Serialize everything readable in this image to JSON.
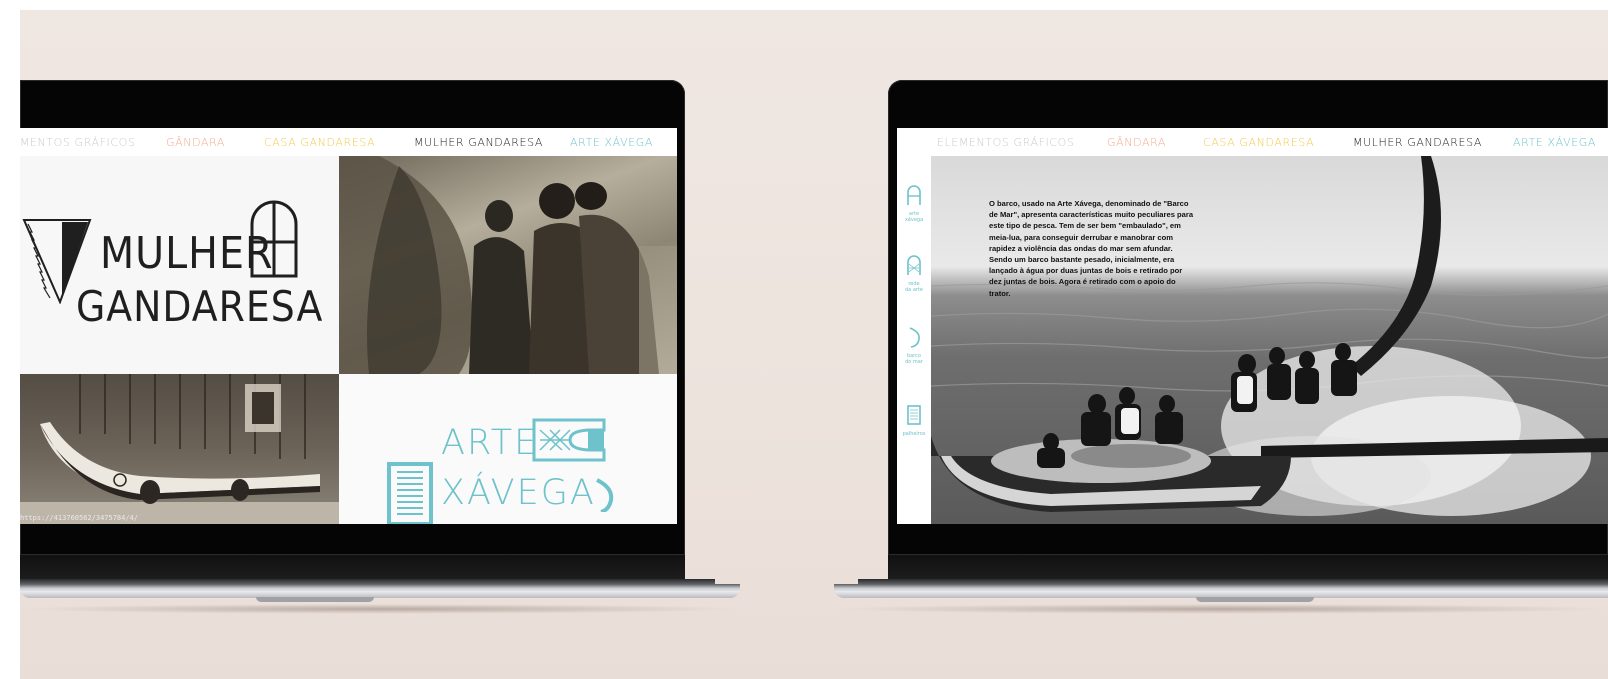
{
  "colors": {
    "backdrop": "#eee5df",
    "accent_teal": "#6dc2cb",
    "accent_peach": "#f0a98c",
    "accent_yellow": "#f2c84b",
    "nav_gray": "#c9c9c9",
    "nav_dark": "#1e1e1e"
  },
  "left_laptop": {
    "nav": [
      {
        "label": "ELEMENTOS GRÁFICOS",
        "color": "#c9c9c9"
      },
      {
        "label": "GÂNDARA",
        "color": "#f0a98c"
      },
      {
        "label": "CASA GANDARESA",
        "color": "#f2c84b"
      },
      {
        "label": "MULHER GANDARESA",
        "color": "#1e1e1e"
      },
      {
        "label": "ARTE XÁVEGA",
        "color": "#6dc2cb"
      }
    ],
    "title_line1": "MULHER",
    "title_line2": "GANDARESA",
    "arte_line1": "ARTE",
    "arte_line2": "XÁVEGA",
    "url_caption": "https://41376056​2/3475784/4/",
    "icons": [
      "triangle-emblem-icon",
      "arch-emblem-icon",
      "net-float-icon",
      "basket-icon",
      "hook-icon"
    ]
  },
  "right_laptop": {
    "nav": [
      {
        "label": "ELEMENTOS GRÁFICOS",
        "color": "#c9c9c9"
      },
      {
        "label": "GÂNDARA",
        "color": "#f0a98c"
      },
      {
        "label": "CASA GANDARESA",
        "color": "#f2c84b"
      },
      {
        "label": "MULHER GANDARESA",
        "color": "#1e1e1e"
      },
      {
        "label": "ARTE XÁVEGA",
        "color": "#6dc2cb"
      }
    ],
    "side_menu": [
      {
        "label_top": "arte",
        "label_bottom": "xávega",
        "icon": "arch-a-icon"
      },
      {
        "label_top": "rede",
        "label_bottom": "da arte",
        "icon": "net-a-icon"
      },
      {
        "label_top": "barco",
        "label_bottom": "do mar",
        "icon": "hook-icon"
      },
      {
        "label_top": "palheiros",
        "label_bottom": "",
        "icon": "palheiro-icon"
      }
    ],
    "body_text": "O barco, usado na Arte Xávega, denominado de \"Barco de Mar\", apresenta características muito peculiares para este tipo de pesca. Tem de ser bem \"embaulado\", em meia-lua, para conseguir derrubar e manobrar com rapidez a violência das ondas do mar sem afundar. Sendo um barco bastante pesado, inicialmente, era lançado à água por duas juntas de bois e retirado por dez juntas de bois. Agora é retirado com o apoio do trator."
  }
}
